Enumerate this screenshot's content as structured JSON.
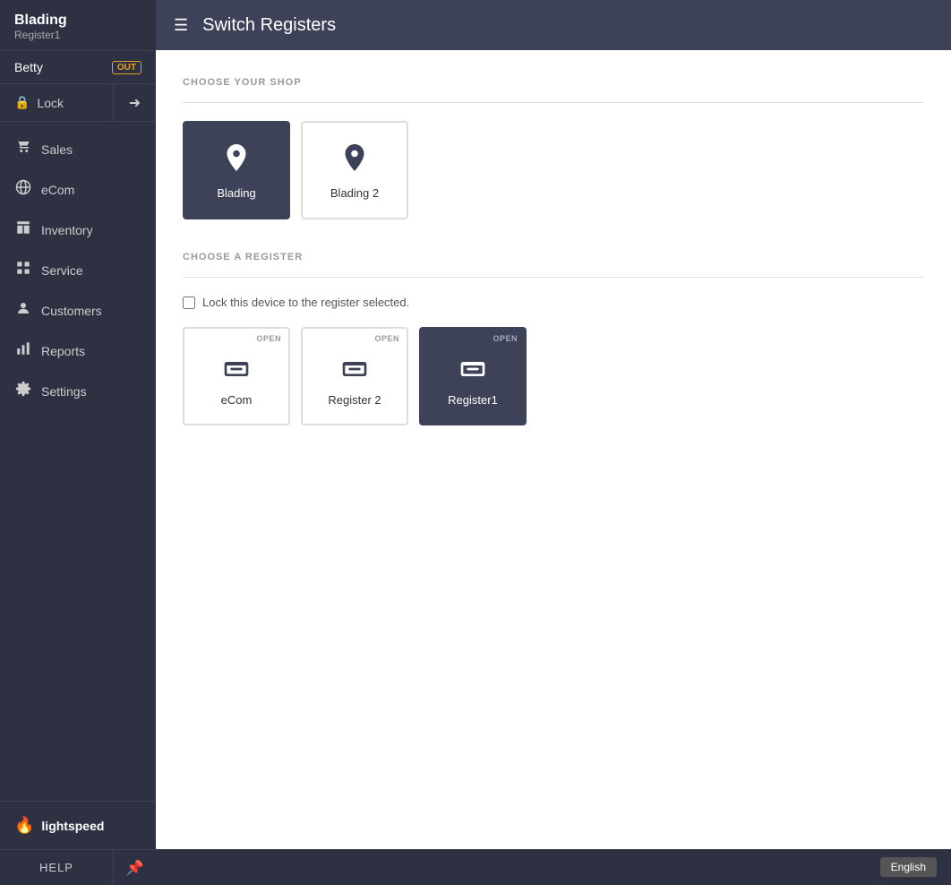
{
  "sidebar": {
    "brand_name": "Blading",
    "register": "Register1",
    "user": "Betty",
    "out_badge": "OUT",
    "lock_label": "Lock",
    "nav_items": [
      {
        "id": "sales",
        "label": "Sales",
        "icon": "💰"
      },
      {
        "id": "ecom",
        "label": "eCom",
        "icon": "🌐"
      },
      {
        "id": "inventory",
        "label": "Inventory",
        "icon": "📦"
      },
      {
        "id": "service",
        "label": "Service",
        "icon": "🔧"
      },
      {
        "id": "customers",
        "label": "Customers",
        "icon": "👤"
      },
      {
        "id": "reports",
        "label": "Reports",
        "icon": "📊"
      },
      {
        "id": "settings",
        "label": "Settings",
        "icon": "⚙️"
      }
    ],
    "logo_text": "lightspeed",
    "help_label": "HELP",
    "language_label": "English"
  },
  "topbar": {
    "title": "Switch Registers",
    "menu_icon": "☰"
  },
  "main": {
    "choose_shop_label": "CHOOSE YOUR SHOP",
    "shops": [
      {
        "id": "blading",
        "label": "Blading",
        "active": true
      },
      {
        "id": "blading2",
        "label": "Blading 2",
        "active": false
      }
    ],
    "choose_register_label": "CHOOSE A REGISTER",
    "lock_device_label": "Lock this device to the register selected.",
    "registers": [
      {
        "id": "ecom",
        "label": "eCom",
        "status": "OPEN",
        "active": false
      },
      {
        "id": "register2",
        "label": "Register 2",
        "status": "OPEN",
        "active": false
      },
      {
        "id": "register1",
        "label": "Register1",
        "status": "OPEN",
        "active": true
      }
    ]
  },
  "bottom": {
    "help_label": "HELP",
    "language_label": "English"
  }
}
